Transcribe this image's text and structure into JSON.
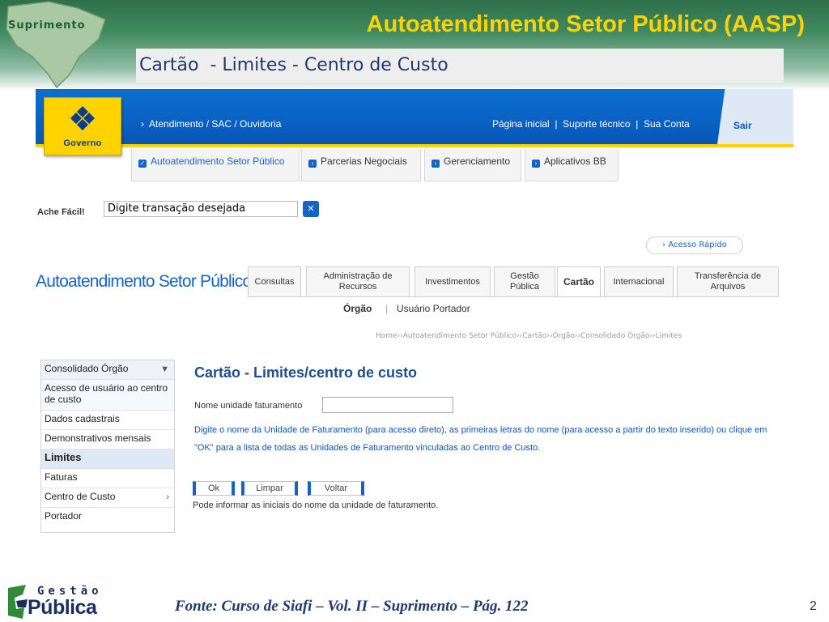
{
  "slide": {
    "logo_word": "Suprimento",
    "title": "Autoatendimento Setor Público (AASP)",
    "subtitle": "Cartão  - Limites - Centro de Custo",
    "footer_note": "Fonte: Curso de Siafi – Vol. II – Suprimento – Pág. 122",
    "page_number": "2",
    "footer_logo_top": "Gestão",
    "footer_logo_bottom": "Pública"
  },
  "site": {
    "logo_text": "Governo",
    "top_link_left": "›  Atendimento / SAC / Ouvidoria",
    "top_links_right": "Página inicial  |  Suporte técnico  |  Sua Conta",
    "sair": "Sair",
    "nav_tabs": [
      "Autoatendimento Setor Público",
      "Parcerias Negociais",
      "Gerenciamento",
      "Aplicativos BB"
    ],
    "ache_facil_label": "Ache Fácil!",
    "ache_facil_value": "Digite transação desejada",
    "ache_facil_button": "✕",
    "acesso_rapido": "› Acesso Rápido",
    "section_heading": "Autoatendimento Setor Público",
    "service_tabs": [
      "Consultas",
      "Administração de Recursos",
      "Investimentos",
      "Gestão Pública",
      "Cartão",
      "Internacional",
      "Transferência de Arquivos"
    ],
    "active_service_tab": "Cartão",
    "sub_tabs": [
      "Órgão",
      "Usuário Portador"
    ],
    "sub_sep": "|",
    "breadcrumb": "Home››Autoatendimento Setor Público››Cartão››Órgão››Consolidado Órgão››Limites"
  },
  "side_menu": {
    "items": [
      "Consolidado Órgão",
      "Acesso de usuário ao centro de custo",
      "Dados cadastrais",
      "Demonstrativos mensais",
      "Limites",
      "Faturas",
      "Centro de Custo",
      "Portador"
    ],
    "active": "Limites",
    "expanded_icon": "chevron-down-icon",
    "submenu_icon": "chevron-right-icon"
  },
  "content": {
    "title": "Cartão - Limites/centro de custo",
    "field_label": "Nome unidade faturamento",
    "field_value": "",
    "help_text": "Digite o nome da Unidade de Faturamento (para acesso direto), as primeiras letras do nome (para acesso a partir do texto inserido) ou clique em \"OK\" para a lista de todas as Unidades de Faturamento vinculadas ao Centro de Custo.",
    "buttons": [
      "Ok",
      "Limpar",
      "Voltar"
    ],
    "hint": "Pode informar as iniciais do nome da unidade de faturamento."
  },
  "colors": {
    "slide_title": "#ffd200",
    "bb_blue": "#0b6fcf",
    "bb_yellow": "#ffd200",
    "link_blue": "#1463c6",
    "title_blue": "#1f4e8c"
  }
}
